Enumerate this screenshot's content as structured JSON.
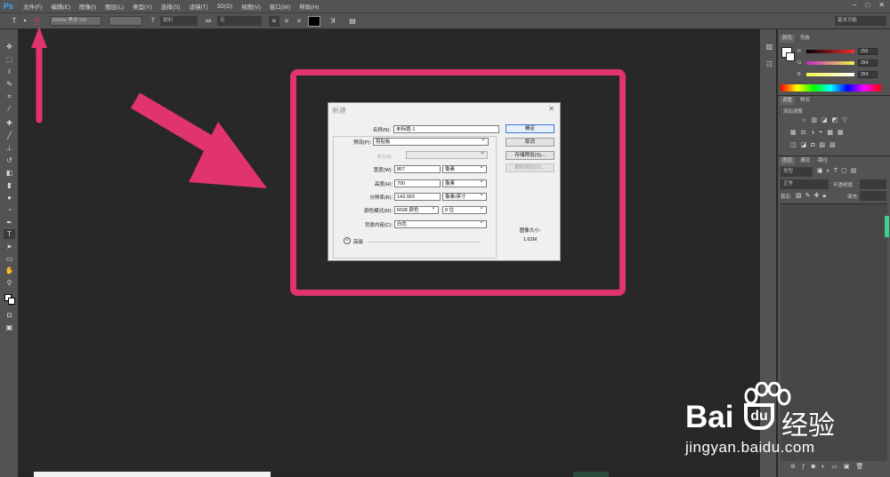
{
  "app": {
    "logo": "Ps",
    "menus": [
      "文件(F)",
      "编辑(E)",
      "图像(I)",
      "图层(L)",
      "类型(Y)",
      "选择(S)",
      "滤镜(T)",
      "3D(D)",
      "视图(V)",
      "窗口(W)",
      "帮助(H)"
    ],
    "window_controls": [
      "–",
      "□",
      "✕"
    ]
  },
  "options_bar": {
    "font_family": "Adobe 黑体 Std",
    "font_style": "-",
    "font_size": "",
    "leading": "锐利",
    "aa_label": "aa",
    "antialias": "无",
    "workspace": "基本功能"
  },
  "panels": {
    "color_tabs": [
      "颜色",
      "色板"
    ],
    "rgb": [
      {
        "label": "R",
        "value": "255",
        "color": "#ff2b2b"
      },
      {
        "label": "G",
        "value": "254",
        "color": "#2bff5a"
      },
      {
        "label": "B",
        "value": "254",
        "color": "#2b6bff"
      }
    ],
    "adjust_tabs": [
      "调整",
      "样式"
    ],
    "adjust_title": "添加调整",
    "layer_tabs": [
      "图层",
      "通道",
      "路径"
    ],
    "layer_kind": "类型",
    "blend_mode": "正常",
    "opacity_label": "不透明度:",
    "lock_label": "锁定:",
    "fill_label": "填充:"
  },
  "dialog": {
    "title": "新建",
    "close": "✕",
    "name_label": "名称(N):",
    "name_value": "未标题-1",
    "preset_label": "预设(P):",
    "preset_value": "剪贴板",
    "size_label": "大小(I):",
    "width_label": "宽度(W):",
    "width_value": "807",
    "width_unit": "像素",
    "height_label": "高度(H):",
    "height_value": "700",
    "height_unit": "像素",
    "resolution_label": "分辨率(R):",
    "resolution_value": "143.993",
    "resolution_unit": "像素/英寸",
    "color_mode_label": "颜色模式(M):",
    "color_mode_value": "RGB 颜色",
    "bit_depth": "8 位",
    "background_label": "背景内容(C):",
    "background_value": "白色",
    "advanced_label": "高级",
    "ok_button": "确定",
    "cancel_button": "取消",
    "save_preset_button": "存储预设(S)...",
    "delete_preset_button": "删除预设(D)...",
    "image_size_label": "图像大小:",
    "image_size_value": "1.62M"
  },
  "watermark": {
    "brand": "Bai",
    "brand_suffix": "经验",
    "url": "jingyan.baidu.com"
  },
  "annotation_color": "#e0336f"
}
